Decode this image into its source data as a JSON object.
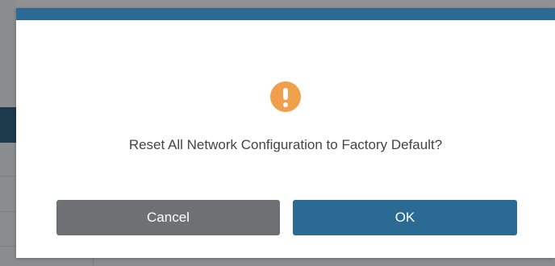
{
  "dialog": {
    "icon": "warning-icon",
    "message": "Reset All Network Configuration to Factory Default?",
    "cancel_label": "Cancel",
    "ok_label": "OK"
  },
  "colors": {
    "header": "#2b6a92",
    "ok_button": "#2b6a92",
    "cancel_button": "#6e7073",
    "warning_icon": "#f0a04a"
  }
}
